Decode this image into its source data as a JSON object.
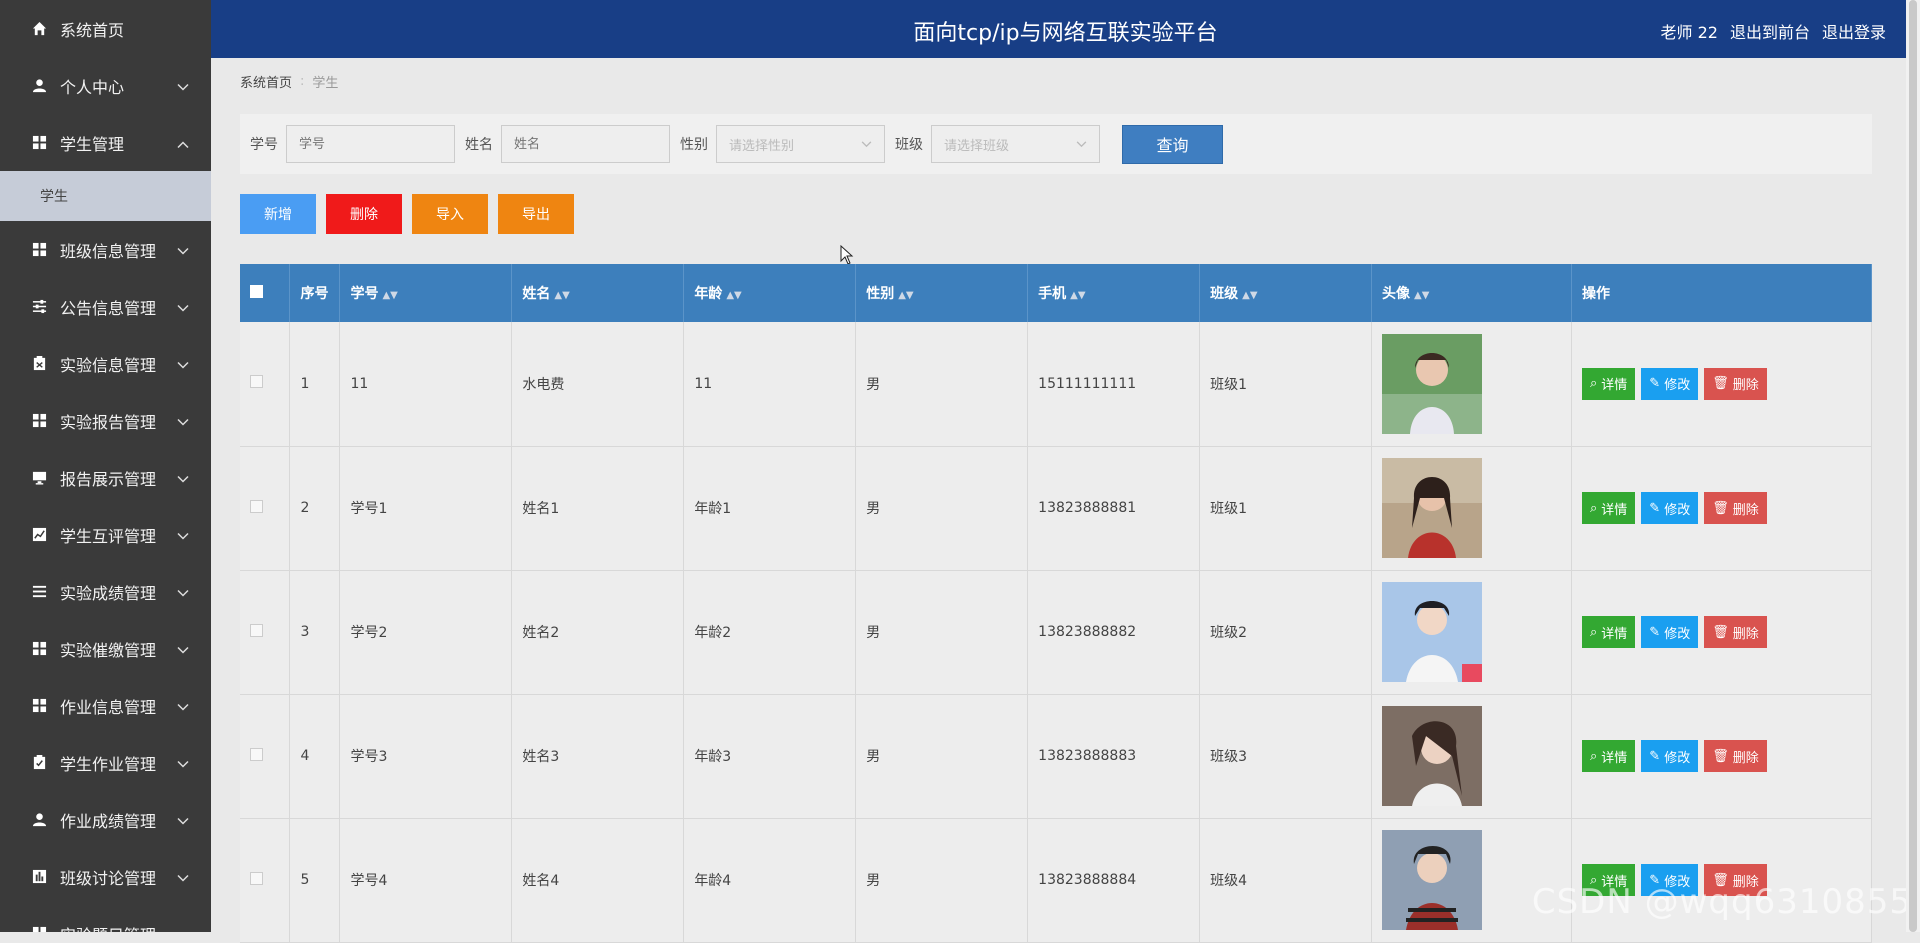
{
  "sidebar": {
    "items": [
      {
        "label": "系统首页",
        "icon": "home-icon"
      },
      {
        "label": "个人中心",
        "icon": "user-icon"
      },
      {
        "label": "学生管理",
        "icon": "grid-icon"
      },
      {
        "label": "学生",
        "icon": ""
      },
      {
        "label": "班级信息管理",
        "icon": "grid-icon"
      },
      {
        "label": "公告信息管理",
        "icon": "sliders-icon"
      },
      {
        "label": "实验信息管理",
        "icon": "clipboard-icon"
      },
      {
        "label": "实验报告管理",
        "icon": "grid-icon"
      },
      {
        "label": "报告展示管理",
        "icon": "monitor-icon"
      },
      {
        "label": "学生互评管理",
        "icon": "chart-icon"
      },
      {
        "label": "实验成绩管理",
        "icon": "list-icon"
      },
      {
        "label": "实验催缴管理",
        "icon": "grid-icon"
      },
      {
        "label": "作业信息管理",
        "icon": "grid-icon"
      },
      {
        "label": "学生作业管理",
        "icon": "clipboard-check-icon"
      },
      {
        "label": "作业成绩管理",
        "icon": "user-icon"
      },
      {
        "label": "班级讨论管理",
        "icon": "bar-icon"
      },
      {
        "label": "实验题目管理",
        "icon": "grid-icon"
      }
    ]
  },
  "header": {
    "title": "面向tcp/ip与网络互联实验平台",
    "user": "老师 22",
    "to_front": "退出到前台",
    "logout": "退出登录"
  },
  "breadcrumb": {
    "home": "系统首页",
    "current": "学生"
  },
  "filters": {
    "student_id_label": "学号",
    "student_id_placeholder": "学号",
    "name_label": "姓名",
    "name_placeholder": "姓名",
    "gender_label": "性别",
    "gender_placeholder": "请选择性别",
    "class_label": "班级",
    "class_placeholder": "请选择班级",
    "query_label": "查询"
  },
  "actions": {
    "add": "新增",
    "delete": "删除",
    "import": "导入",
    "export": "导出"
  },
  "table": {
    "headers": [
      "序号",
      "学号",
      "姓名",
      "年龄",
      "性别",
      "手机",
      "班级",
      "头像",
      "操作"
    ],
    "rows": [
      {
        "index": "1",
        "student_id": "11",
        "name": "水电费",
        "age": "11",
        "gender": "男",
        "phone": "15111111111",
        "class": "班级1"
      },
      {
        "index": "2",
        "student_id": "学号1",
        "name": "姓名1",
        "age": "年龄1",
        "gender": "男",
        "phone": "13823888881",
        "class": "班级1"
      },
      {
        "index": "3",
        "student_id": "学号2",
        "name": "姓名2",
        "age": "年龄2",
        "gender": "男",
        "phone": "13823888882",
        "class": "班级2"
      },
      {
        "index": "4",
        "student_id": "学号3",
        "name": "姓名3",
        "age": "年龄3",
        "gender": "男",
        "phone": "13823888883",
        "class": "班级3"
      },
      {
        "index": "5",
        "student_id": "学号4",
        "name": "姓名4",
        "age": "年龄4",
        "gender": "男",
        "phone": "13823888884",
        "class": "班级4"
      }
    ],
    "op_detail": "详情",
    "op_edit": "修改",
    "op_delete": "删除"
  },
  "watermark": "CSDN @wqq6310855",
  "colors": {
    "sidebar_bg": "#3a3a3a",
    "header_bg": "#183e86",
    "table_header_bg": "#3d7fbc",
    "add_btn": "#4a9df3",
    "delete_btn": "#f01a1a",
    "import_export_btn": "#ef8511",
    "detail_btn": "#33a832",
    "edit_btn": "#1a9ff0",
    "row_delete_btn": "#d9534f"
  }
}
